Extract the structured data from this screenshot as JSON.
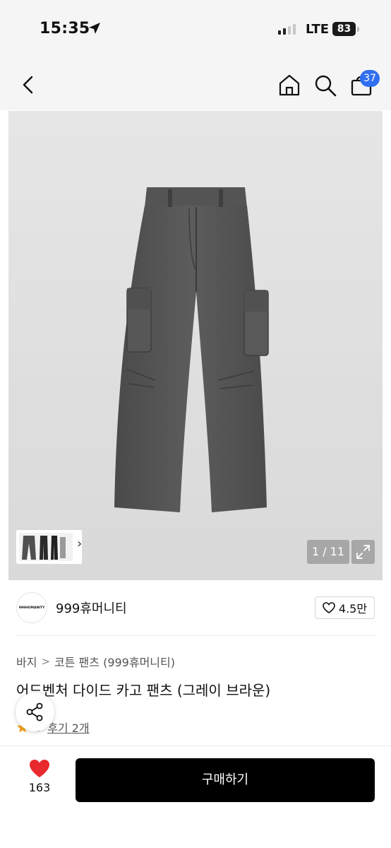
{
  "status_bar": {
    "time": "15:35",
    "network": "LTE",
    "battery": "83"
  },
  "nav": {
    "cart_count": "37",
    "icons": [
      "back-icon",
      "home-icon",
      "search-icon",
      "cart-icon"
    ]
  },
  "gallery": {
    "page_indicator": "1 / 11",
    "thumb_next": "›",
    "image_subject": "grey-brown cargo pants"
  },
  "brand": {
    "logo_text": "999HUMANITY",
    "name": "999휴머니티",
    "likes": "4.5만"
  },
  "breadcrumb": {
    "items": [
      "바지",
      "코튼 팬츠 (999휴머니티)"
    ],
    "separator": ">"
  },
  "product": {
    "title": "어드벤처 다이드 카고 팬츠 (그레이 브라운)",
    "rating": "5",
    "reviews": "후기 2개"
  },
  "bottom_bar": {
    "wish_count": "163",
    "buy_label": "구매하기"
  },
  "colors": {
    "accent": "#2f6ff0",
    "heart": "#e8292e",
    "star": "#f5a623",
    "buy_button": "#000000"
  }
}
